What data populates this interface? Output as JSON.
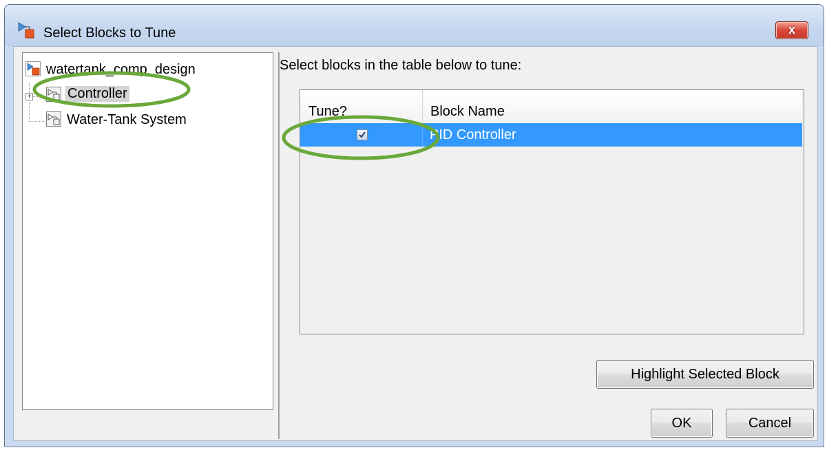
{
  "window": {
    "title": "Select Blocks to Tune",
    "close_glyph": "x"
  },
  "tree": {
    "root": {
      "label": "watertank_comp_design",
      "icon": "model-icon"
    },
    "children": [
      {
        "label": "Controller",
        "icon": "subsystem-icon",
        "selected": true,
        "expandable": true,
        "expander_glyph": "+"
      },
      {
        "label": "Water-Tank System",
        "icon": "subsystem-icon",
        "selected": false,
        "expandable": false
      }
    ]
  },
  "panel": {
    "instruction": "Select blocks in the table below to tune:"
  },
  "table": {
    "columns": [
      "Tune?",
      "Block Name"
    ],
    "rows": [
      {
        "tune": true,
        "block_name": "PID Controller",
        "selected": true
      }
    ]
  },
  "buttons": {
    "highlight": "Highlight Selected Block",
    "ok": "OK",
    "cancel": "Cancel"
  },
  "colors": {
    "selection": "#3399ff",
    "annotation": "#6aa83a",
    "close_button": "#d9473a"
  }
}
